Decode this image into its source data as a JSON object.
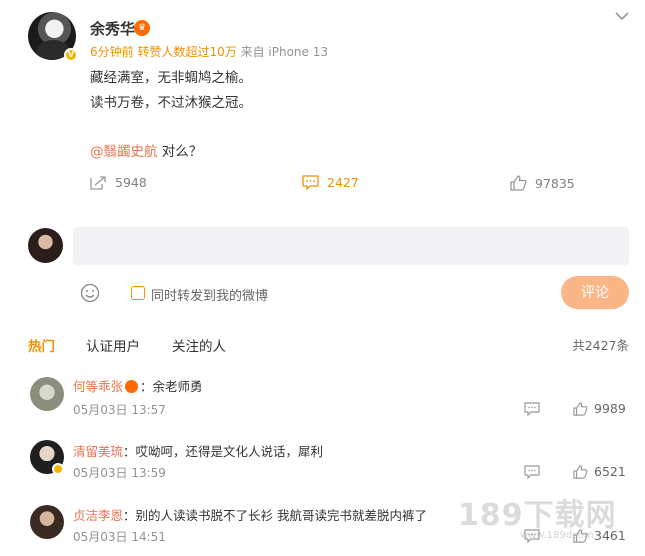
{
  "post": {
    "author": "余秀华",
    "meta_time": "6分钟前",
    "meta_reposts": "转赞人数超过10万",
    "meta_source": "来自 iPhone 13",
    "lines": [
      "藏经满室，无非蜩鸠之榆。",
      "读书万卷，不过沐猴之冠。"
    ],
    "mention": "@翳蠲史航",
    "mention_suffix": " 对么？",
    "repost_count": "5948",
    "comment_count": "2427",
    "like_count": "97835"
  },
  "compose": {
    "placeholder": "",
    "repost_label": "同时转发到我的微博",
    "submit_label": "评论"
  },
  "tabs": {
    "hot": "热门",
    "verified": "认证用户",
    "following": "关注的人",
    "total": "共2427条"
  },
  "comments": [
    {
      "user": "何等乖张",
      "text": "：余老师勇",
      "time": "05月03日 13:57",
      "likes": "9989"
    },
    {
      "user": "清留美琉",
      "text": "：哎呦呵，还得是文化人说话，犀利",
      "time": "05月03日 13:59",
      "likes": "6521"
    },
    {
      "user": "贞洁李恩",
      "text": "：别的人读读书脱不了长衫 我航哥读完书就差脱内裤了",
      "time": "05月03日 14:51",
      "likes": "3461"
    }
  ],
  "watermark": {
    "main": "189下载网",
    "sub": "www.189dcom"
  },
  "colors": {
    "accent": "#f09100",
    "mention": "#eb7350",
    "submit": "#fbb688"
  }
}
